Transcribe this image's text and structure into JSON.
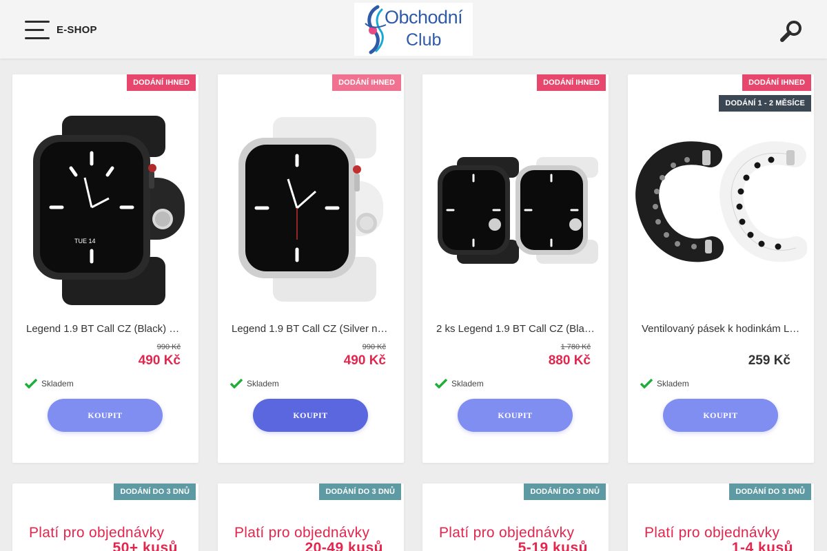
{
  "header": {
    "menu_label": "E-SHOP",
    "logo_line1": "Obchodní",
    "logo_line2": "Club"
  },
  "products": [
    {
      "badges": [
        "DODÁNÍ IHNED"
      ],
      "title": "Legend 1.9 BT Call CZ (Black) …",
      "old_price": "990 Kč",
      "price": "490 Kč",
      "stock": "Skladem",
      "buy_label": "KOUPIT"
    },
    {
      "badges": [
        "DODÁNÍ IHNED"
      ],
      "title": "Legend 1.9 BT Call CZ (Silver n…",
      "old_price": "990 Kč",
      "price": "490 Kč",
      "stock": "Skladem",
      "buy_label": "KOUPIT"
    },
    {
      "badges": [
        "DODÁNÍ IHNED"
      ],
      "title": "2 ks Legend 1.9 BT Call CZ (Bla…",
      "old_price": "1 780 Kč",
      "price": "880 Kč",
      "stock": "Skladem",
      "buy_label": "KOUPIT"
    },
    {
      "badges": [
        "DODÁNÍ IHNED",
        "DODÁNÍ 1 - 2 MĚSÍCE"
      ],
      "title": "Ventilovaný pásek k hodinkám L…",
      "price": "259 Kč",
      "stock": "Skladem",
      "buy_label": "KOUPIT"
    }
  ],
  "offers": [
    {
      "badge": "DODÁNÍ DO 3 DNŮ",
      "line1": "Platí pro objednávky",
      "line2": "50+ kusů"
    },
    {
      "badge": "DODÁNÍ DO 3 DNŮ",
      "line1": "Platí pro objednávky",
      "line2": "20-49 kusů"
    },
    {
      "badge": "DODÁNÍ DO 3 DNŮ",
      "line1": "Platí pro objednávky",
      "line2": "5-19 kusů"
    },
    {
      "badge": "DODÁNÍ DO 3 DNŮ",
      "line1": "Platí pro objednávky",
      "line2": "1-4 kusů"
    }
  ],
  "colors": {
    "accent_red": "#e2264d",
    "badge_red": "#e8476d",
    "badge_dark": "#3b4753",
    "badge_teal": "#5e9aa3",
    "button": "#7f8ef0",
    "button_active": "#5a67df",
    "stock_green": "#1fae3a"
  },
  "icons": {
    "menu": "hamburger-icon",
    "search": "magnifier-icon",
    "stock": "checkmark-icon"
  }
}
